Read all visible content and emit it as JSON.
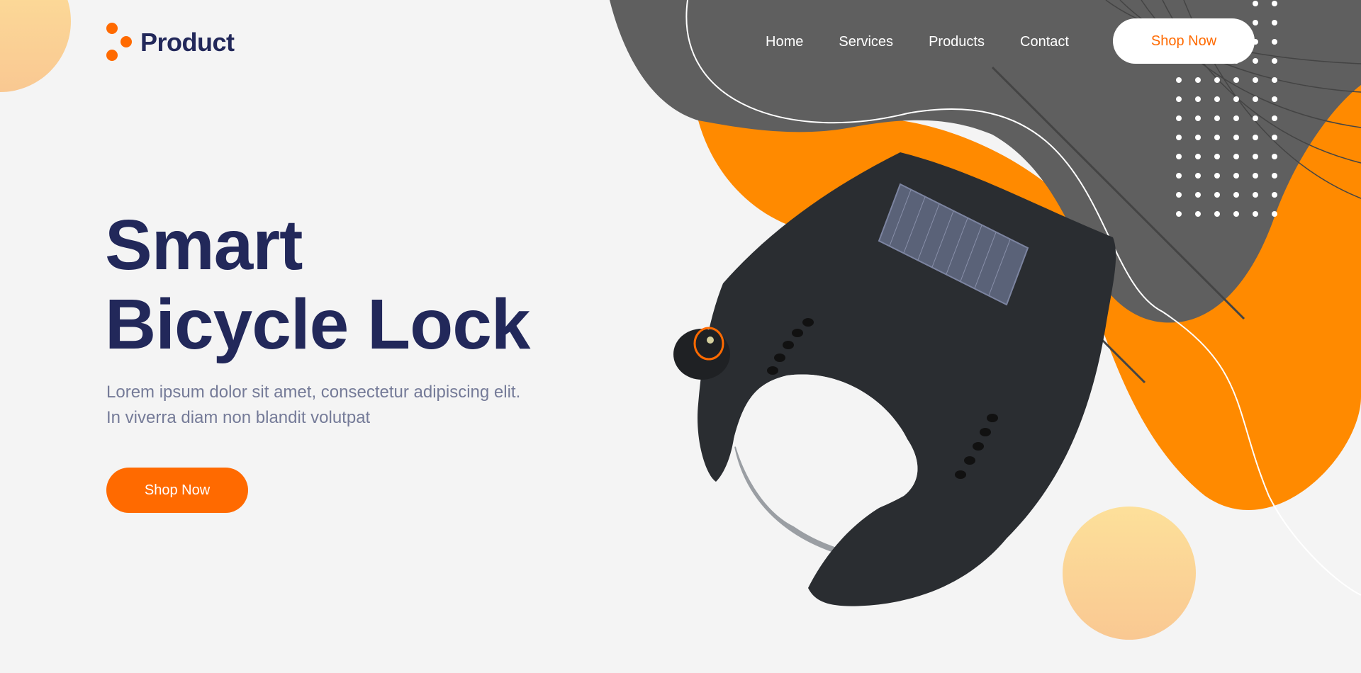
{
  "brand": {
    "name": "Product",
    "logo_icon": "three-dots-icon",
    "accent_color": "#ff6a00",
    "dark_color": "#22285a"
  },
  "nav": {
    "items": [
      {
        "label": "Home"
      },
      {
        "label": "Services"
      },
      {
        "label": "Products"
      },
      {
        "label": "Contact"
      }
    ],
    "cta_label": "Shop Now"
  },
  "hero": {
    "title_line1": "Smart",
    "title_line2": "Bicycle Lock",
    "desc_line1": "Lorem ipsum dolor sit amet, consectetur adipiscing elit.",
    "desc_line2": "In viverra diam non blandit volutpat",
    "cta_label": "Shop Now"
  },
  "decor": {
    "grey_blob_color": "#5f5f5f",
    "orange_blob_color": "#ff8a00",
    "peach_gradient": [
      "#fde09a",
      "#f9c892"
    ],
    "product_image": "smart-bicycle-lock-image"
  }
}
